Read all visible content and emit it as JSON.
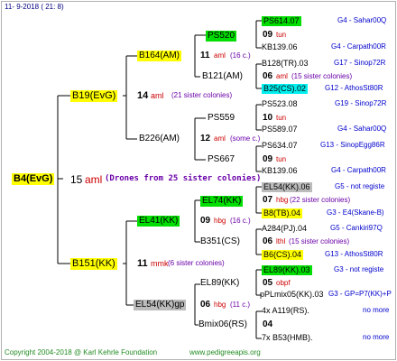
{
  "header": "11-  9-2018 (  21:  8)",
  "footer": {
    "copyright": "Copyright 2004-2018 @ Karl Kehrle Foundation",
    "url": "www.pedigreeapis.org"
  },
  "root": {
    "name": "B4(EvG)",
    "num": "15",
    "tag": "aml",
    "note": "(Drones from 25 sister colonies)"
  },
  "gen1": [
    {
      "name": "B19(EvG)",
      "num": "14",
      "tag": "aml",
      "note": "(21 sister colonies)"
    },
    {
      "name": "B151(KK)",
      "num": "11",
      "tag": "mmk",
      "note": "(6 sister colonies)"
    }
  ],
  "gen2": [
    {
      "name": "B164(AM)",
      "num": "11",
      "tag": "aml",
      "note": "(16 c.)"
    },
    {
      "name": "B226(AM)",
      "num": "12",
      "tag": "aml",
      "note": "(some c.)"
    },
    {
      "name": "EL41(KK)",
      "num": "09",
      "tag": "hbg",
      "note": "(16 c.)"
    },
    {
      "name": "EL54(KK)gp",
      "num": "06",
      "tag": "hbg",
      "note": "(11 c.)"
    }
  ],
  "gen3": [
    {
      "name": "PS520",
      "num": "09",
      "tag": "tun",
      "note": ""
    },
    {
      "name": "B121(AM)",
      "num": "06",
      "tag": "aml",
      "note": "(15 sister colonies)"
    },
    {
      "name": "PS559",
      "num": "10",
      "tag": "tun",
      "note": ""
    },
    {
      "name": "PS667",
      "num": "09",
      "tag": "tun",
      "note": ""
    },
    {
      "name": "EL74(KK)",
      "num": "07",
      "tag": "hbg",
      "note": "(22 sister colonies)"
    },
    {
      "name": "B351(CS)",
      "num": "06",
      "tag": "lthl",
      "note": "(15 sister colonies)"
    },
    {
      "name": "EL89(KK)",
      "num": "05",
      "tag": "obpf",
      "note": ""
    },
    {
      "name": "Bmix06(RS)",
      "num": "04",
      "tag": "",
      "note": ""
    }
  ],
  "gen4": [
    {
      "name": "PS614.07",
      "info": "G4 - Sahar00Q"
    },
    {
      "name": "KB139.06",
      "info": "G4 - Carpath00R"
    },
    {
      "name": "B128(TR).03",
      "info": "G17 - Sinop72R"
    },
    {
      "name": "B25(CS).02",
      "info": "G12 - AthosSt80R"
    },
    {
      "name": "PS523.08",
      "info": "G19 - Sinop72R"
    },
    {
      "name": "PS589.07",
      "info": "G4 - Sahar00Q"
    },
    {
      "name": "PS634.07",
      "info": "G13 - SinopEgg86R"
    },
    {
      "name": "KB139.06",
      "info": "G4 - Carpath00R"
    },
    {
      "name": "EL54(KK).06",
      "info": "G5 - not registe"
    },
    {
      "name": "B8(TB).04",
      "info": "G3 - E4(Skane-B)"
    },
    {
      "name": "A284(PJ).04",
      "info": "G5 - Cankiri97Q"
    },
    {
      "name": "B6(CS).04",
      "info": "G13 - AthosSt80R"
    },
    {
      "name": "EL89(KK).03",
      "info": "G3 - not registe"
    },
    {
      "name": "pPLmix05(KK).03",
      "info": "G3 - GP=P7(KK)+P"
    },
    {
      "name": "4x A119(RS).",
      "info": "no more"
    },
    {
      "name": "7x B53(HMB).",
      "info": "no more"
    }
  ],
  "colors": {
    "header": "#000080",
    "tag": "#cc0000",
    "sister": "#6a00a8",
    "info": "#0000cc",
    "footer": "#228b22"
  }
}
